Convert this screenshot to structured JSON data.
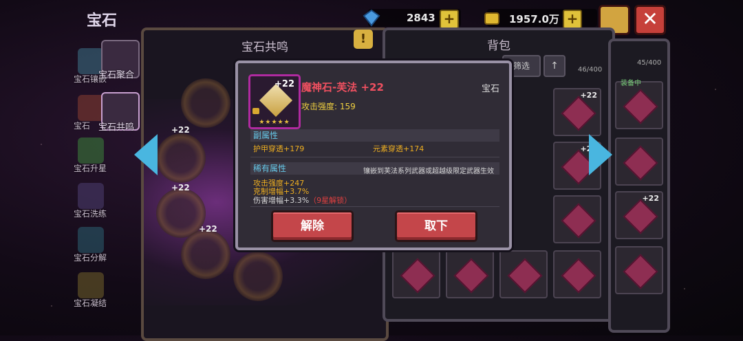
{
  "header": {
    "title": "宝石",
    "diamonds": "2843",
    "gold": "1957.0万"
  },
  "sidebar": {
    "items": [
      {
        "label": "宝石镶嵌"
      },
      {
        "label": "宝石"
      },
      {
        "label": "宝石升星"
      },
      {
        "label": "宝石洗练"
      },
      {
        "label": "宝石分解"
      },
      {
        "label": "宝石凝结"
      }
    ],
    "tabs": [
      {
        "label": "宝石聚合"
      },
      {
        "label": "宝石共鸣"
      }
    ]
  },
  "resonance": {
    "title": "宝石共鸣",
    "slot_levels": [
      "+22",
      "+22",
      "+22",
      "+22"
    ]
  },
  "backpack": {
    "title": "背包",
    "filter_label": "筛选",
    "count": "46/400",
    "count2": "45/400",
    "equipped_label": "装备中",
    "cell_level": "+22"
  },
  "dialog": {
    "item_name": "魔神石-芙法 +22",
    "item_type": "宝石",
    "item_level": "+22",
    "attack": "攻击强度: 159",
    "secondary_header": "副属性",
    "secondary": [
      "护甲穿透+179",
      "元素穿透+174"
    ],
    "rare_header": "稀有属性",
    "rare_note": "镶嵌到芙法系列武器或超越级限定武器生效",
    "rare": [
      "攻击强度+247",
      "克制增幅+3.7%",
      "伤害增幅+3.3%"
    ],
    "rare_locked": "（9星解锁）",
    "btn_remove": "解除",
    "btn_unequip": "取下"
  },
  "colors": {
    "accent_red": "#c4464a",
    "arrow_blue": "#49b6e0",
    "item_name": "#f05060"
  },
  "icons": [
    "diamond-icon",
    "gold-icon",
    "plus-icon",
    "close-icon",
    "help-icon",
    "exclamation-icon",
    "arrow-left-icon",
    "arrow-right-icon",
    "lock-icon"
  ]
}
